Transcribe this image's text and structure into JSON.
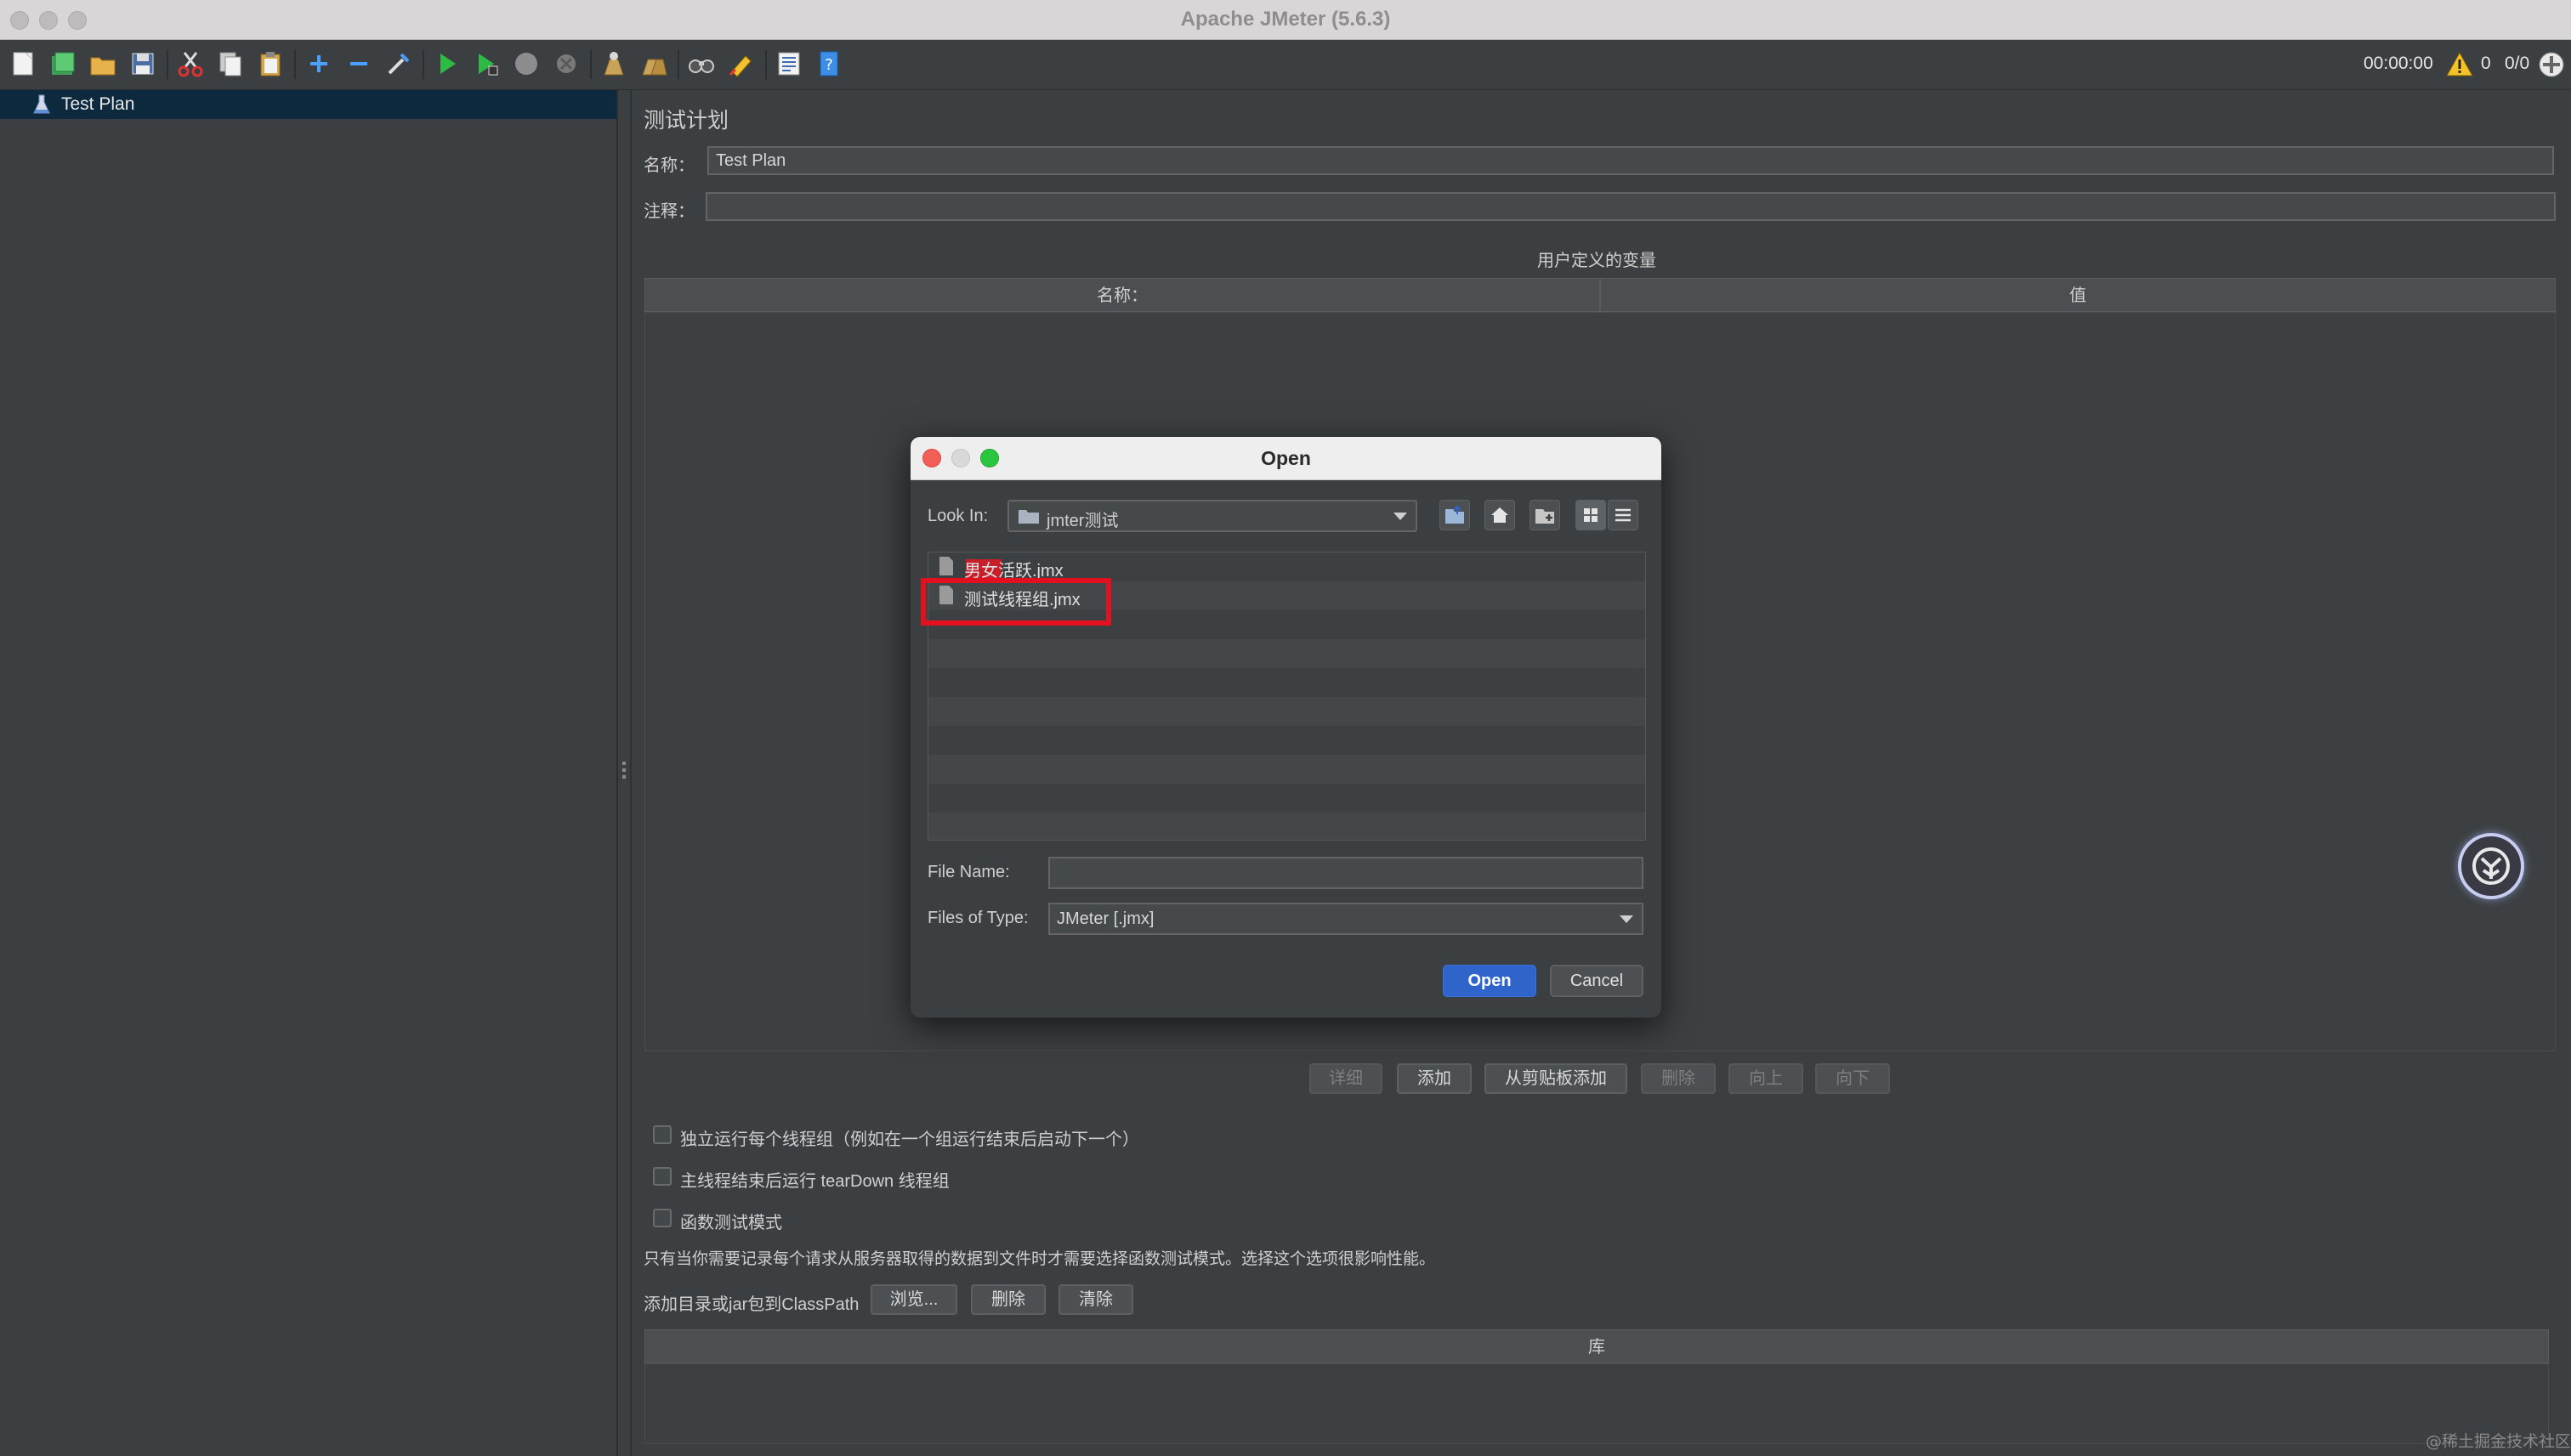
{
  "window": {
    "title": "Apache JMeter (5.6.3)"
  },
  "toolbar": {
    "timer": "00:00:00",
    "warning_count": "0",
    "thread_count": "0/0",
    "icons": [
      "new-icon",
      "templates-icon",
      "open-icon",
      "save-icon",
      "cut-icon",
      "copy-icon",
      "paste-icon",
      "expand-icon",
      "collapse-icon",
      "toggle-icon",
      "start-icon",
      "start-no-pause-icon",
      "stop-icon",
      "shutdown-icon",
      "clear-icon",
      "clear-all-icon",
      "search-icon",
      "reset-search-icon",
      "function-helper-icon",
      "help-icon"
    ]
  },
  "tree": {
    "items": [
      {
        "label": "Test Plan",
        "icon": "flask-icon",
        "selected": true
      }
    ]
  },
  "plan": {
    "heading": "测试计划",
    "name_label": "名称：",
    "name_value": "Test Plan",
    "comment_label": "注释：",
    "comment_value": "",
    "udv_title": "用户定义的变量",
    "udv_columns": [
      "名称：",
      "值"
    ],
    "udv_buttons": [
      "详细",
      "添加",
      "从剪贴板添加",
      "删除",
      "向上",
      "向下"
    ],
    "options": [
      {
        "label": "独立运行每个线程组（例如在一个组运行结束后启动下一个）",
        "checked": false
      },
      {
        "label": "主线程结束后运行 tearDown 线程组",
        "checked": false
      },
      {
        "label": "函数测试模式",
        "checked": false
      }
    ],
    "functional_note": "只有当你需要记录每个请求从服务器取得的数据到文件时才需要选择函数测试模式。选择这个选项很影响性能。",
    "classpath_label": "添加目录或jar包到ClassPath",
    "classpath_buttons": [
      "浏览...",
      "删除",
      "清除"
    ],
    "library_header": "库"
  },
  "dialog": {
    "title": "Open",
    "look_in_label": "Look In:",
    "look_in_value": "jmter测试",
    "nav_icons": [
      "up-folder-icon",
      "home-icon",
      "new-folder-icon",
      "list-view-icon",
      "details-view-icon"
    ],
    "files": [
      "男女活跃.jmx",
      "测试线程组.jmx"
    ],
    "file_name_label": "File Name:",
    "file_name_value": "",
    "files_of_type_label": "Files of Type:",
    "files_of_type_value": "JMeter [.jmx]",
    "open_label": "Open",
    "cancel_label": "Cancel"
  },
  "watermark": "@稀土掘金技术社区",
  "colors": {
    "accent": "#2f65ca",
    "highlight": "#e3101f",
    "background": "#3c3f41"
  }
}
